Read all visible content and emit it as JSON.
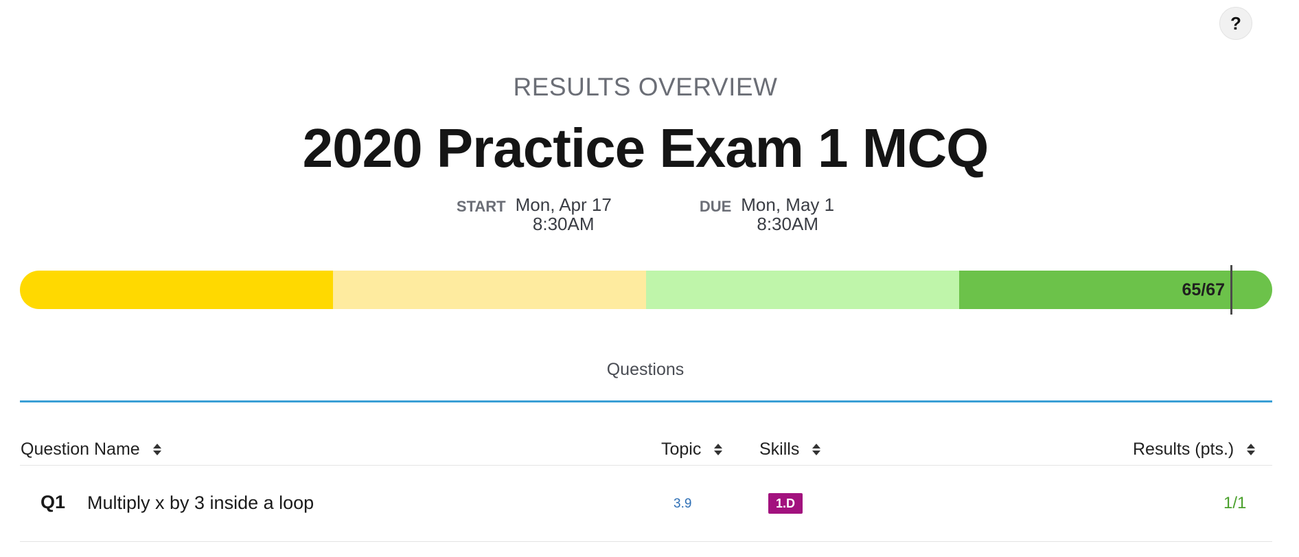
{
  "help": {
    "label": "?"
  },
  "header": {
    "overline": "RESULTS OVERVIEW",
    "title": "2020 Practice Exam 1 MCQ"
  },
  "dates": {
    "start": {
      "label": "START",
      "day": "Mon, Apr 17",
      "time": "8:30AM"
    },
    "due": {
      "label": "DUE",
      "day": "Mon, May 1",
      "time": "8:30AM"
    }
  },
  "score": {
    "text": "65/67",
    "earned": 65,
    "possible": 67,
    "band_colors": [
      "#ffd900",
      "#feeb9f",
      "#bff5aa",
      "#6cc24a"
    ]
  },
  "tabs": {
    "questions": "Questions",
    "accent": "#3a9fd5"
  },
  "table": {
    "columns": {
      "name": "Question Name",
      "topic": "Topic",
      "skills": "Skills",
      "results": "Results (pts.)"
    },
    "sort_icon": "sort-updown-icon",
    "rows": [
      {
        "number": "Q1",
        "name": "Multiply x by 3 inside a loop",
        "topic": "3.9",
        "skill": "1.D",
        "skill_color": "#a2127e",
        "result": "1/1"
      }
    ]
  }
}
